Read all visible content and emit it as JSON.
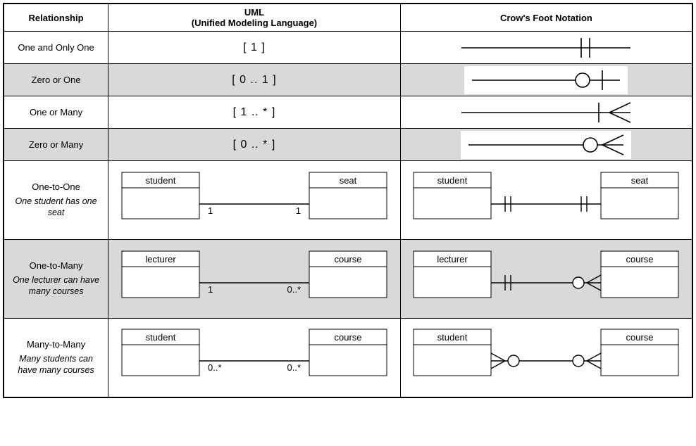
{
  "header": {
    "relationship": "Relationship",
    "uml_line1": "UML",
    "uml_line2": "(Unified Modeling Language)",
    "crowsfoot": "Crow's Foot Notation"
  },
  "rows": {
    "r1": {
      "label": "One and Only One",
      "uml": "[ 1 ]"
    },
    "r2": {
      "label": "Zero or One",
      "uml": "[ 0 .. 1 ]"
    },
    "r3": {
      "label": "One or Many",
      "uml": "[ 1 .. * ]"
    },
    "r4": {
      "label": "Zero or Many",
      "uml": "[ 0 .. * ]"
    },
    "r5": {
      "label": "One-to-One",
      "desc": "One student has one seat",
      "leftEntity": "student",
      "rightEntity": "seat",
      "leftCard": "1",
      "rightCard": "1"
    },
    "r6": {
      "label": "One-to-Many",
      "desc": "One lecturer can have many courses",
      "leftEntity": "lecturer",
      "rightEntity": "course",
      "leftCard": "1",
      "rightCard": "0..*"
    },
    "r7": {
      "label": "Many-to-Many",
      "desc": "Many students can have many courses",
      "leftEntity": "student",
      "rightEntity": "course",
      "leftCard": "0..*",
      "rightCard": "0..*"
    }
  }
}
